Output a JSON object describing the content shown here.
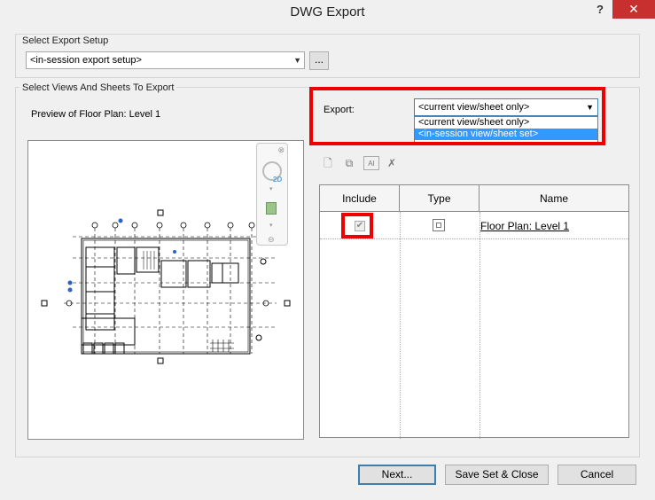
{
  "window": {
    "title": "DWG Export",
    "help": "?",
    "close": "✕"
  },
  "setup": {
    "group_label": "Select Export Setup",
    "selected": "<in-session export setup>",
    "browse_label": "..."
  },
  "views": {
    "group_label": "Select Views And Sheets To Export",
    "preview_label": "Preview of Floor Plan: Level 1",
    "export_label": "Export:",
    "export_selected": "<current view/sheet only>",
    "export_options": [
      "<current view/sheet only>",
      "<in-session view/sheet set>"
    ],
    "highlighted_option_index": 1
  },
  "table": {
    "headers": [
      "Include",
      "Type",
      "Name"
    ],
    "rows": [
      {
        "include": true,
        "type_icon": "floor-plan-view-icon",
        "name": "Floor Plan: Level 1"
      }
    ]
  },
  "buttons": {
    "next": "Next...",
    "save_close": "Save Set & Close",
    "cancel": "Cancel"
  },
  "colors": {
    "highlight_box": "#ee0000",
    "selection": "#3399ff",
    "close_button": "#c7302e"
  }
}
